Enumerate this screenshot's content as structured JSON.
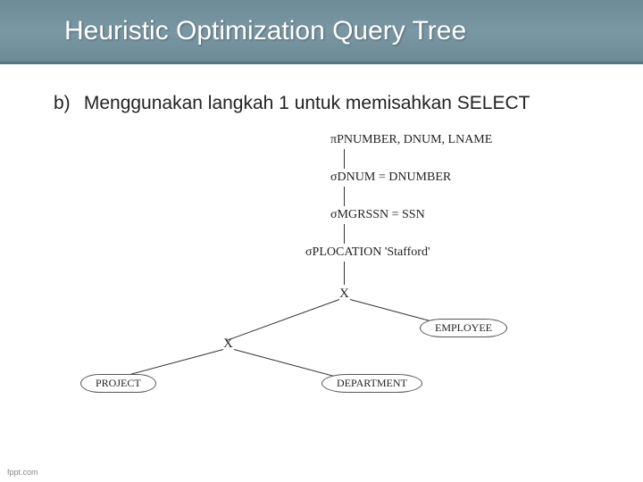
{
  "header": {
    "title": "Heuristic Optimization Query Tree"
  },
  "content": {
    "list_marker": "b)",
    "list_text": "Menggunakan langkah 1 untuk memisahkan SELECT"
  },
  "diagram": {
    "pi": "πPNUMBER, DNUM, LNAME",
    "sigma1": "σDNUM = DNUMBER",
    "sigma2": "σMGRSSN = SSN",
    "sigma3": "σPLOCATION   'Stafford'",
    "cross1": "X",
    "cross2": "X",
    "leaf_employee": "EMPLOYEE",
    "leaf_project": "PROJECT",
    "leaf_department": "DEPARTMENT"
  },
  "footer": {
    "text": "fppt.com"
  }
}
